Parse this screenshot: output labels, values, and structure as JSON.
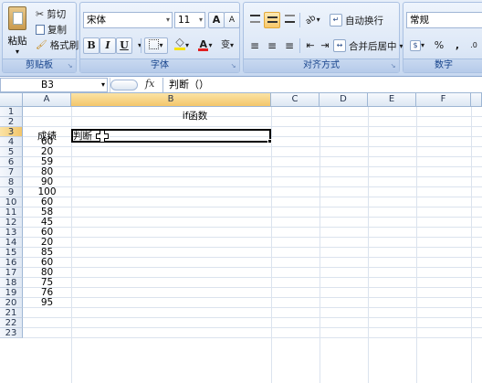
{
  "ribbon": {
    "clipboard": {
      "paste_label": "粘贴",
      "paste_dropdown": "▾",
      "cut_label": "剪切",
      "copy_label": "复制",
      "format_painter_label": "格式刷",
      "group_title": "剪贴板",
      "launcher": "↘"
    },
    "font": {
      "font_name": "宋体",
      "font_size": "11",
      "grow_font": "A",
      "shrink_font": "A",
      "bold": "B",
      "italic": "I",
      "underline": "U",
      "border_icon": "border-icon",
      "fill_color_icon": "fill-color-icon",
      "font_color_icon": "font-color-icon",
      "font_color": "#e02020",
      "fill_color": "#f7e20a",
      "phonetic": "变",
      "group_title": "字体",
      "launcher": "↘"
    },
    "alignment": {
      "wrap_text_label": "自动换行",
      "merge_center_label": "合并后居中",
      "group_title": "对齐方式",
      "launcher": "↘"
    },
    "number": {
      "format_value": "常规",
      "percent": "%",
      "comma": ",",
      "group_title": "数字"
    }
  },
  "formula_bar": {
    "name_box": "B3",
    "fx": "fx",
    "formula": "判断（）"
  },
  "grid": {
    "columns": [
      "A",
      "B",
      "C",
      "D",
      "E",
      "F"
    ],
    "rows": [
      "1",
      "2",
      "3",
      "4",
      "5",
      "6",
      "7",
      "8",
      "9",
      "10",
      "11",
      "12",
      "13",
      "14",
      "15",
      "16",
      "17",
      "18",
      "19",
      "20",
      "21",
      "22",
      "23"
    ],
    "selected_column": "B",
    "selected_row": "3",
    "b1": "if函数",
    "a3": "成绩",
    "b3": "判断（",
    "scores": [
      "60",
      "20",
      "59",
      "80",
      "90",
      "100",
      "60",
      "58",
      "45",
      "60",
      "20",
      "85",
      "60",
      "80",
      "75",
      "76",
      "95"
    ]
  }
}
